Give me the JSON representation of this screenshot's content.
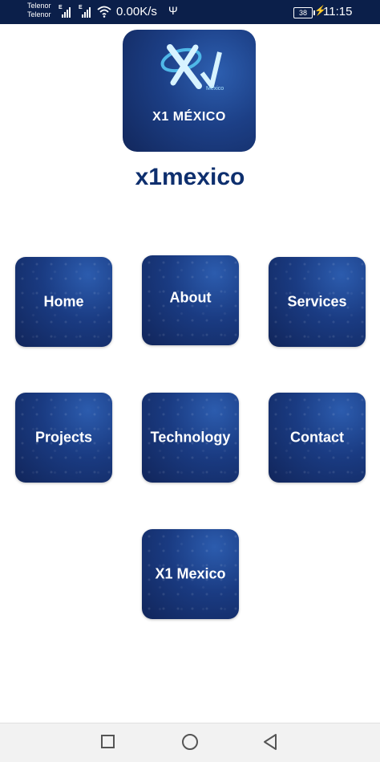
{
  "status_bar": {
    "carrier_1": "Telenor",
    "carrier_2": "Telenor",
    "network_type_1": "E",
    "network_type_2": "E",
    "speed": "0.00K/s",
    "usb_icon": "usb-icon",
    "battery": "38",
    "time": "11:15"
  },
  "logo": {
    "small_text": "México",
    "caption": "X1 MÉXICO"
  },
  "app_title": "x1mexico",
  "menu": [
    {
      "label": "Home"
    },
    {
      "label": "About"
    },
    {
      "label": "Services"
    },
    {
      "label": "Projects"
    },
    {
      "label": "Technology"
    },
    {
      "label": "Contact"
    },
    {
      "label": "X1 Mexico"
    }
  ],
  "nav_bar": {
    "recents_icon": "square-icon",
    "home_icon": "circle-icon",
    "back_icon": "triangle-back-icon"
  },
  "colors": {
    "tile": "#1a3b82",
    "title": "#0e2f6e",
    "status_bar": "#0b1f4a"
  }
}
